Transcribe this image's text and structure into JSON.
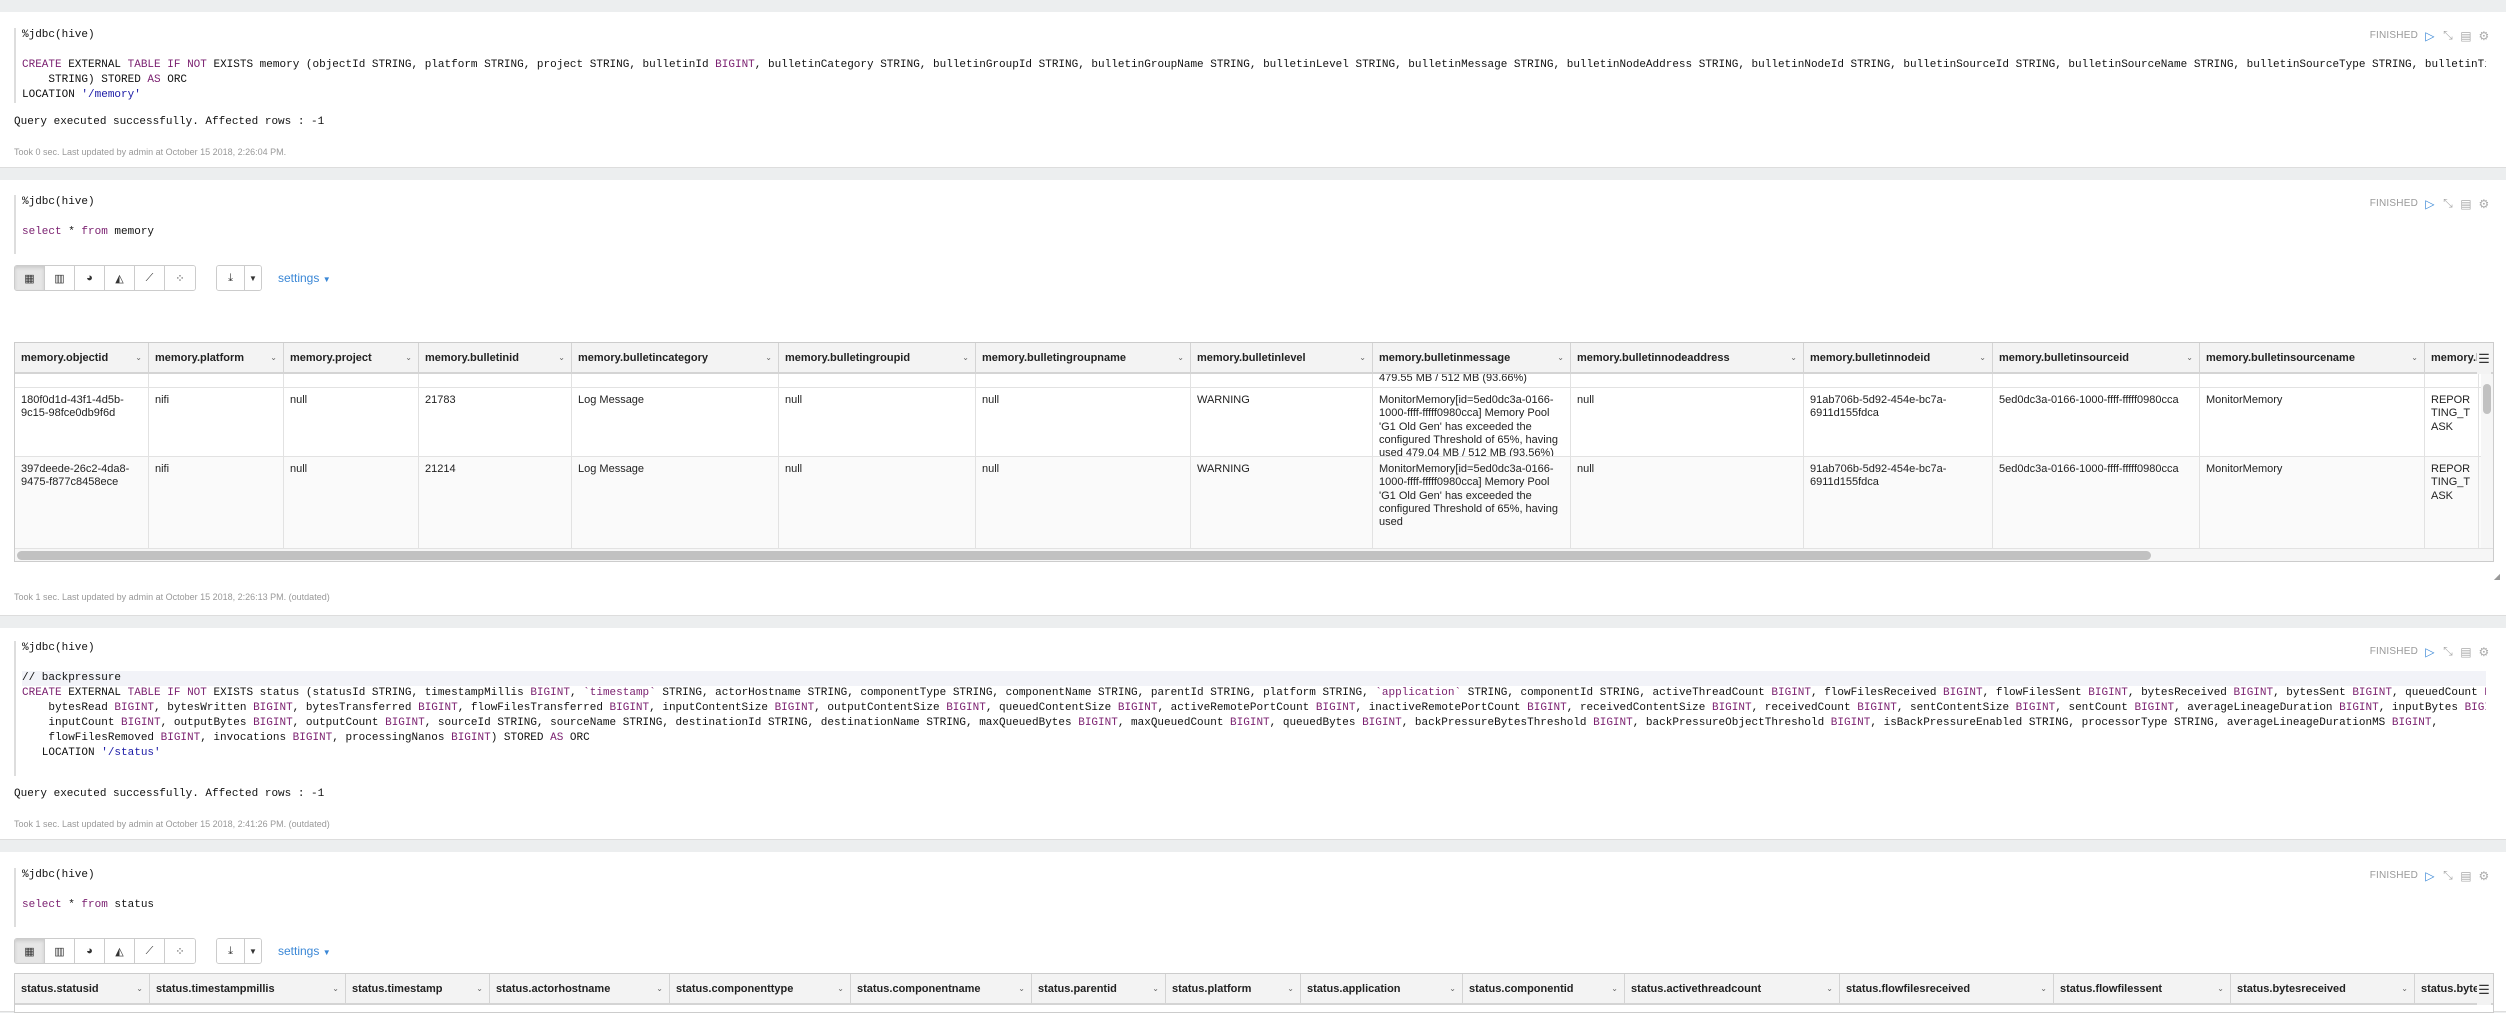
{
  "paragraphs": [
    {
      "status": "FINISHED",
      "code": [
        "%jdbc(hive)",
        "",
        "CREATE EXTERNAL TABLE IF NOT EXISTS memory (objectId STRING, platform STRING, project STRING, bulletinId BIGINT, bulletinCategory STRING, bulletinGroupId STRING, bulletinGroupName STRING, bulletinLevel STRING, bulletinMessage STRING, bulletinNodeAddress STRING, bulletinNodeId STRING, bulletinSourceId STRING, bulletinSourceName STRING, bulletinSourceType STRING, bulletinTimestamp",
        "    STRING) STORED AS ORC",
        "LOCATION '/memory'"
      ],
      "result": "Query executed successfully. Affected rows : -1",
      "took": "Took 0 sec. Last updated by admin at October 15 2018, 2:26:04 PM."
    },
    {
      "status": "FINISHED",
      "code": [
        "%jdbc(hive)",
        "",
        "select * from memory"
      ],
      "settings_label": "settings",
      "table": {
        "columns": [
          "memory.objectid",
          "memory.platform",
          "memory.project",
          "memory.bulletinid",
          "memory.bulletincategory",
          "memory.bulletingroupid",
          "memory.bulletingroupname",
          "memory.bulletinlevel",
          "memory.bulletinmessage",
          "memory.bulletinnodeaddress",
          "memory.bulletinnodeid",
          "memory.bulletinsourceid",
          "memory.bulletinsourcename",
          "memory.bulletinsourcetype"
        ],
        "partial_row": [
          "",
          "",
          "",
          "",
          "",
          "",
          "",
          "",
          "479.55 MB / 512 MB (93.66%)",
          "",
          "",
          "",
          "",
          ""
        ],
        "rows": [
          [
            "180f0d1d-43f1-4d5b-9c15-98fce0db9f6d",
            "nifi",
            "null",
            "21783",
            "Log Message",
            "null",
            "null",
            "WARNING",
            "MonitorMemory[id=5ed0dc3a-0166-1000-ffff-fffff0980cca] Memory Pool 'G1 Old Gen' has exceeded the configured Threshold of 65%, having used 479.04 MB / 512 MB (93.56%)",
            "null",
            "91ab706b-5d92-454e-bc7a-6911d155fdca",
            "5ed0dc3a-0166-1000-ffff-fffff0980cca",
            "MonitorMemory",
            "REPORTING_TASK"
          ],
          [
            "397deede-26c2-4da8-9475-f877c8458ece",
            "nifi",
            "null",
            "21214",
            "Log Message",
            "null",
            "null",
            "WARNING",
            "MonitorMemory[id=5ed0dc3a-0166-1000-ffff-fffff0980cca] Memory Pool 'G1 Old Gen' has exceeded the configured Threshold of 65%, having used",
            "null",
            "91ab706b-5d92-454e-bc7a-6911d155fdca",
            "5ed0dc3a-0166-1000-ffff-fffff0980cca",
            "MonitorMemory",
            "REPORTING_TASK"
          ]
        ]
      },
      "took": "Took 1 sec. Last updated by admin at October 15 2018, 2:26:13 PM. (outdated)"
    },
    {
      "status": "FINISHED",
      "code": [
        "%jdbc(hive)",
        "",
        "// backpressure",
        "CREATE EXTERNAL TABLE IF NOT EXISTS status (statusId STRING, timestampMillis BIGINT, `timestamp` STRING, actorHostname STRING, componentType STRING, componentName STRING, parentId STRING, platform STRING, `application` STRING, componentId STRING, activeThreadCount BIGINT, flowFilesReceived BIGINT, flowFilesSent BIGINT, bytesReceived BIGINT, bytesSent BIGINT, queuedCount BIGINT,",
        "    bytesRead BIGINT, bytesWritten BIGINT, bytesTransferred BIGINT, flowFilesTransferred BIGINT, inputContentSize BIGINT, outputContentSize BIGINT, queuedContentSize BIGINT, activeRemotePortCount BIGINT, inactiveRemotePortCount BIGINT, receivedContentSize BIGINT, receivedCount BIGINT, sentContentSize BIGINT, sentCount BIGINT, averageLineageDuration BIGINT, inputBytes BIGINT,",
        "    inputCount BIGINT, outputBytes BIGINT, outputCount BIGINT, sourceId STRING, sourceName STRING, destinationId STRING, destinationName STRING, maxQueuedBytes BIGINT, maxQueuedCount BIGINT, queuedBytes BIGINT, backPressureBytesThreshold BIGINT, backPressureObjectThreshold BIGINT, isBackPressureEnabled STRING, processorType STRING, averageLineageDurationMS BIGINT,",
        "    flowFilesRemoved BIGINT, invocations BIGINT, processingNanos BIGINT) STORED AS ORC",
        "   LOCATION '/status'",
        ""
      ],
      "result": "Query executed successfully. Affected rows : -1",
      "took": "Took 1 sec. Last updated by admin at October 15 2018, 2:41:26 PM. (outdated)"
    },
    {
      "status": "FINISHED",
      "code": [
        "%jdbc(hive)",
        "",
        "select * from status"
      ],
      "settings_label": "settings",
      "table": {
        "columns": [
          "status.statusid",
          "status.timestampmillis",
          "status.timestamp",
          "status.actorhostname",
          "status.componenttype",
          "status.componentname",
          "status.parentid",
          "status.platform",
          "status.application",
          "status.componentid",
          "status.activethreadcount",
          "status.flowfilesreceived",
          "status.flowfilessent",
          "status.bytesreceived",
          "status.bytessent"
        ]
      }
    }
  ],
  "icons": {
    "run": "play-icon",
    "hide": "collapse-icon",
    "book": "book-icon",
    "settings": "gear-icon",
    "viz": [
      "table-icon",
      "bar-chart-icon",
      "pie-chart-icon",
      "area-chart-icon",
      "line-chart-icon",
      "scatter-chart-icon"
    ],
    "download": "download-icon"
  },
  "colors": {
    "keyword": "#7a1f6f",
    "string": "#1a1aa6",
    "link": "#3a87d6",
    "status": "#999999"
  }
}
